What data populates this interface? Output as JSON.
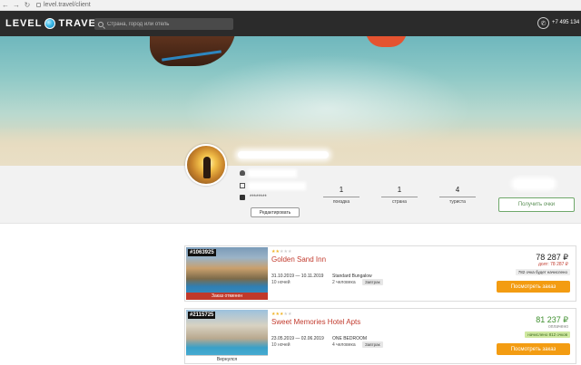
{
  "browser": {
    "url": "level.travel/client"
  },
  "header": {
    "logo_left": "LEVEL",
    "logo_right": "TRAVEL",
    "search_placeholder": "Страна, город или отель",
    "phone": "+7 495 134"
  },
  "profile": {
    "password_mask": "********",
    "edit_label": "Редактировать",
    "stats": [
      {
        "value": "1",
        "label": "поездка"
      },
      {
        "value": "1",
        "label": "страна"
      },
      {
        "value": "4",
        "label": "туриста"
      }
    ],
    "bonus_button": "Получить очки"
  },
  "orders": [
    {
      "id": "#1063925",
      "status": "Заказ отменен",
      "stars": 2,
      "hotel": "Golden Sand Inn",
      "dates": "31.10.2019 — 10.11.2019",
      "nights": "10 ночей",
      "room": "Standard Bungalow",
      "guests": "2 человека",
      "badge": "Завтрак",
      "price": "78 287 ₽",
      "subtext": "долг: 78 287 ₽",
      "points": "782 очка будет начислено",
      "button": "Посмотреть заказ"
    },
    {
      "id": "#2115725",
      "status": "Вернулся",
      "stars": 3,
      "hotel": "Sweet Memories Hotel Apts",
      "dates": "23.05.2019 — 02.06.2019",
      "nights": "10 ночей",
      "room": "ONE BEDROOM",
      "guests": "4 человека",
      "badge": "Завтрак",
      "price": "81 237 ₽",
      "subtext": "оплачено",
      "points": "начислено 812 очков",
      "button": "Посмотреть заказ"
    }
  ],
  "colors": {
    "header_bg": "#2b2b2b",
    "accent_orange": "#f39c12",
    "hotel_red": "#c23b2e",
    "paid_green": "#3f8f2f"
  }
}
